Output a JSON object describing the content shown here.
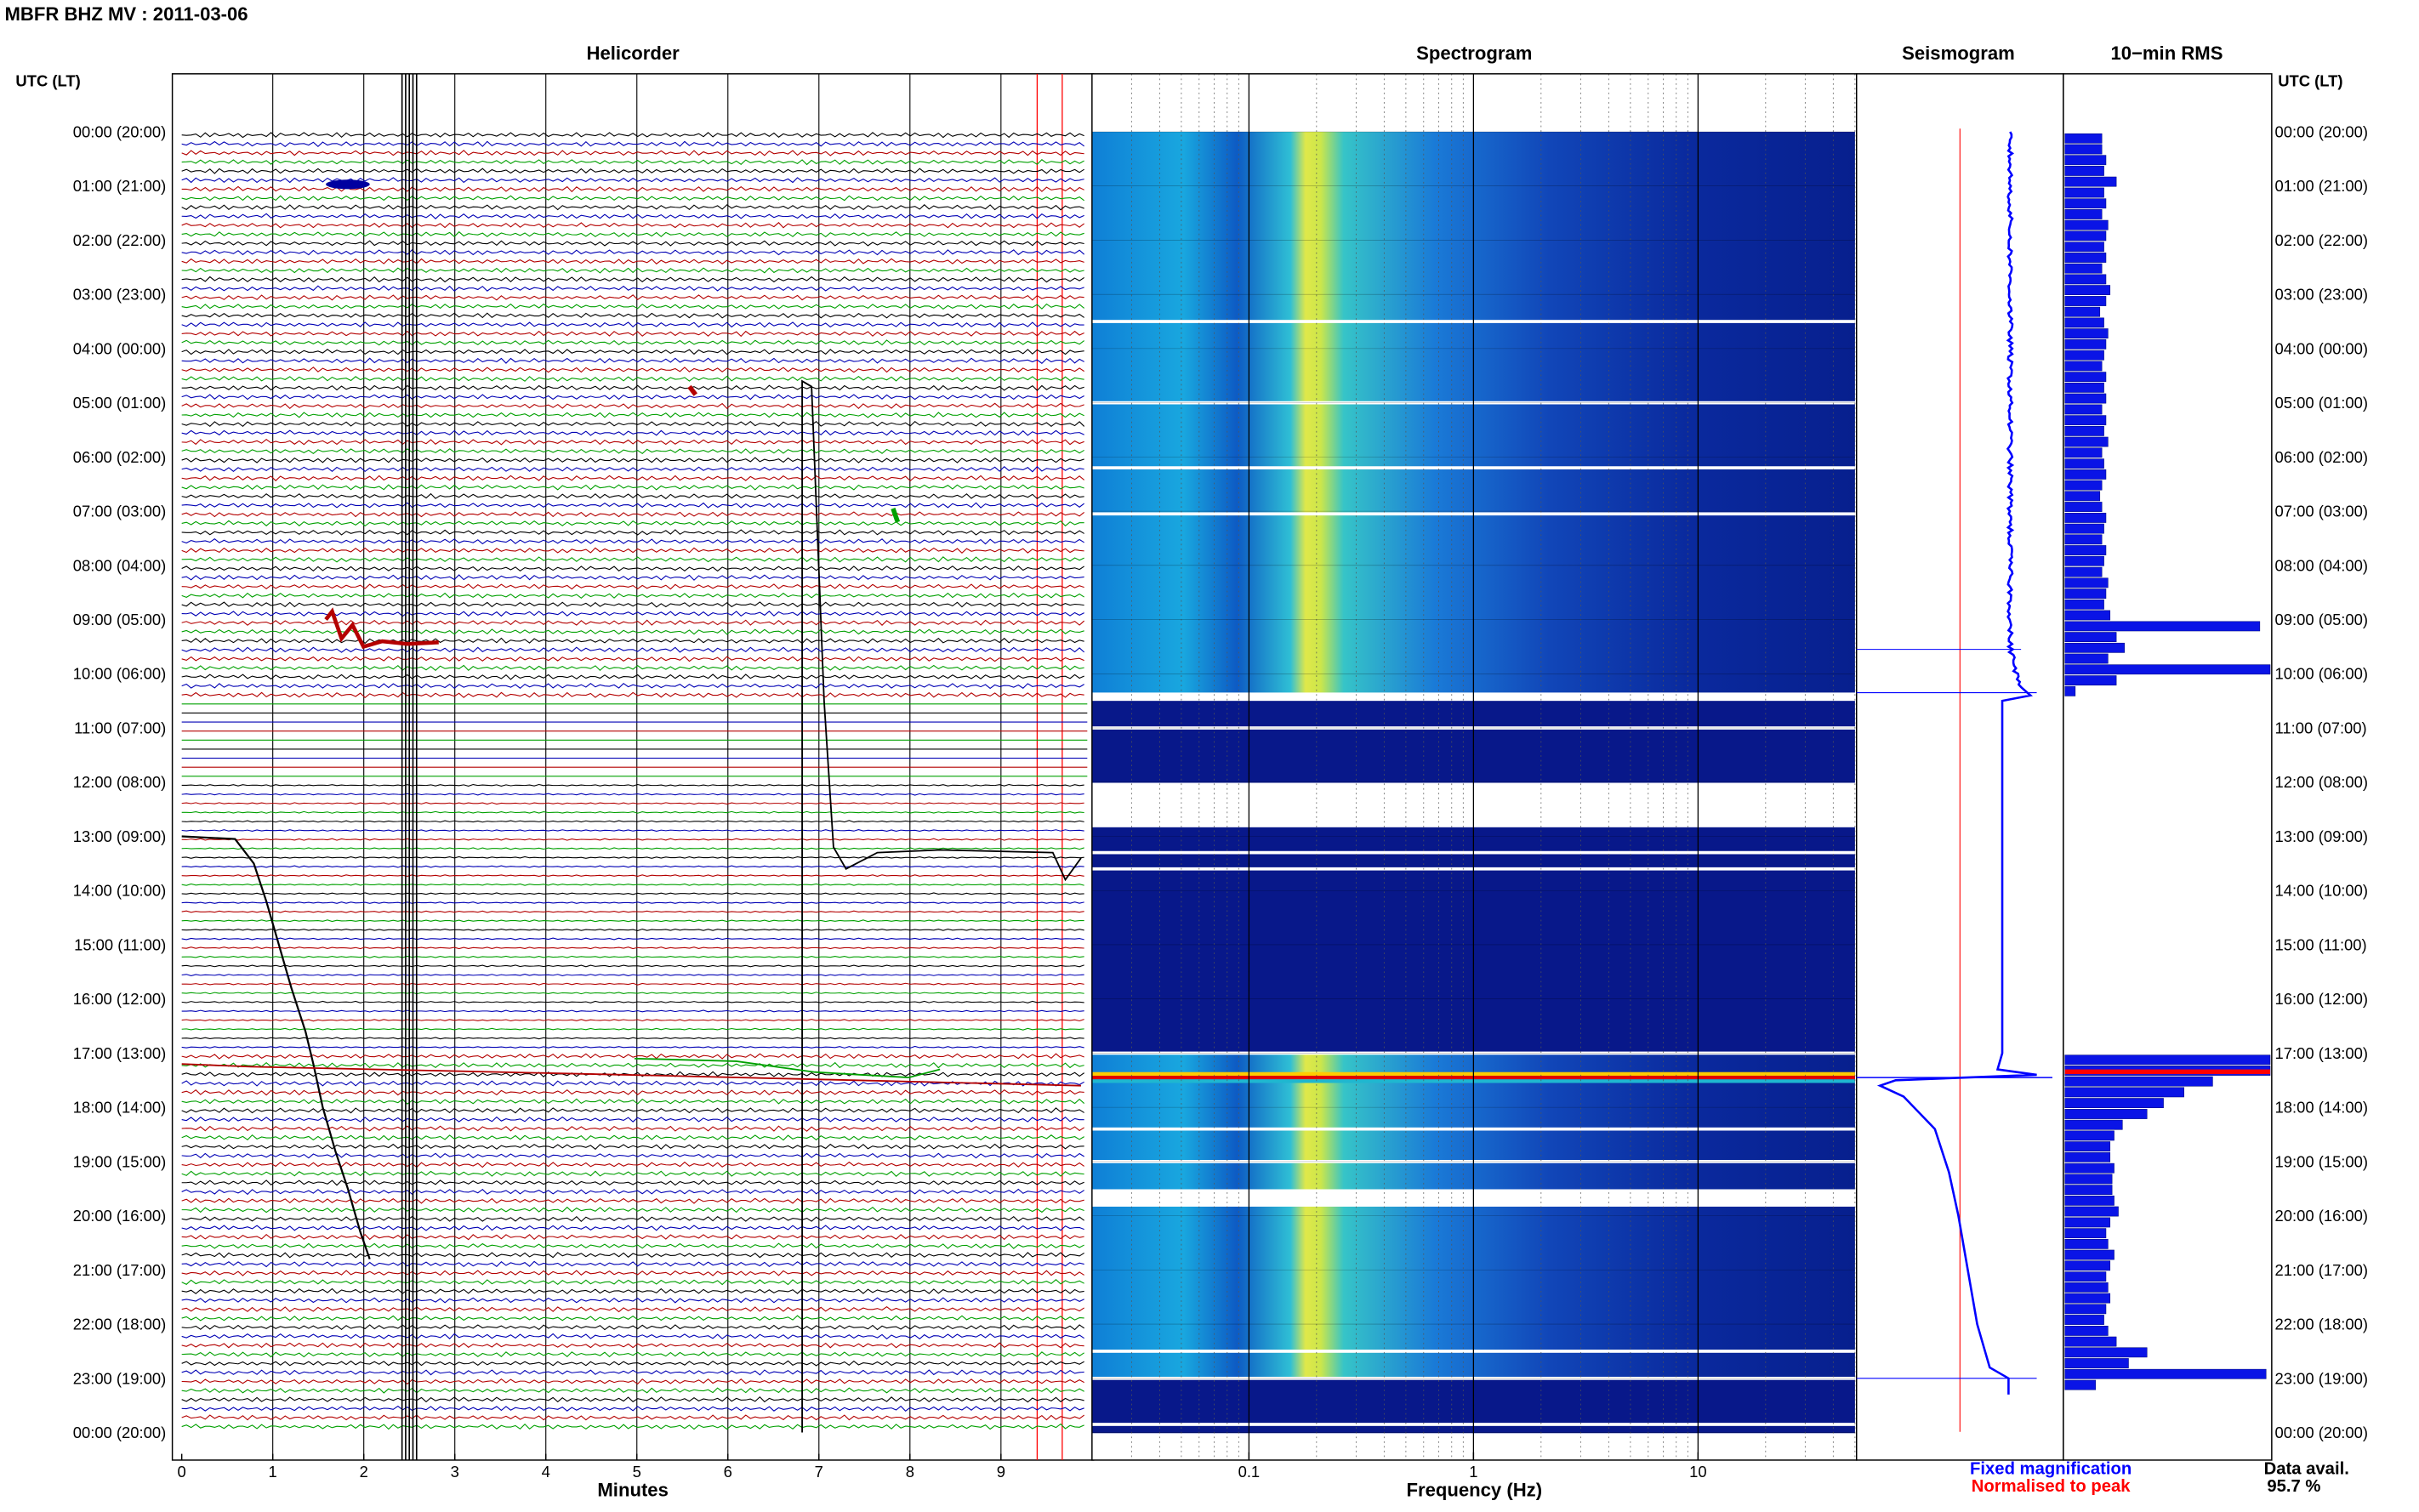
{
  "header": {
    "station_title": "MBFR BHZ MV : 2011-03-06"
  },
  "panels": {
    "helicorder_title": "Helicorder",
    "spectrogram_title": "Spectrogram",
    "seismogram_title": "Seismogram",
    "rms_title": "10−min RMS"
  },
  "axes": {
    "time_axis_label": "UTC (LT)",
    "time_ticks": [
      "00:00 (20:00)",
      "01:00 (21:00)",
      "02:00 (22:00)",
      "03:00 (23:00)",
      "04:00 (00:00)",
      "05:00 (01:00)",
      "06:00 (02:00)",
      "07:00 (03:00)",
      "08:00 (04:00)",
      "09:00 (05:00)",
      "10:00 (06:00)",
      "11:00 (07:00)",
      "12:00 (08:00)",
      "13:00 (09:00)",
      "14:00 (10:00)",
      "15:00 (11:00)",
      "16:00 (12:00)",
      "17:00 (13:00)",
      "18:00 (14:00)",
      "19:00 (15:00)",
      "20:00 (16:00)",
      "21:00 (17:00)",
      "22:00 (18:00)",
      "23:00 (19:00)",
      "00:00 (20:00)"
    ],
    "minutes_label": "Minutes",
    "minutes_ticks": [
      "0",
      "1",
      "2",
      "3",
      "4",
      "5",
      "6",
      "7",
      "8",
      "9"
    ],
    "frequency_label": "Frequency (Hz)",
    "frequency_ticks": [
      "0.1",
      "1",
      "10"
    ]
  },
  "legend": {
    "fixed_label": "Fixed magnification",
    "normalised_label": "Normalised to peak",
    "fixed_color": "#0000ff",
    "normalised_color": "#ff0000"
  },
  "availability": {
    "label": "Data avail.",
    "value": "95.7 %"
  },
  "chart_data": [
    {
      "type": "line",
      "panel": "helicorder",
      "xlabel": "Minutes",
      "xlim": [
        0,
        10
      ],
      "ylim": [
        "00:00",
        "24:00"
      ],
      "row_minutes": 10,
      "trace_colors": [
        "#000000",
        "#0000b4",
        "#b40000",
        "#00a000"
      ],
      "gaps_hours": [
        [
          10.4,
          12.0
        ]
      ],
      "events_hours": [
        1.0,
        9.4,
        17.5
      ]
    },
    {
      "type": "heatmap",
      "panel": "spectrogram",
      "xlabel": "Frequency (Hz)",
      "xscale": "log",
      "xlim": [
        0.02,
        50
      ],
      "peak_band_hz": [
        0.2,
        0.28
      ],
      "gaps_hours": [
        [
          12.0,
          12.75
        ],
        [
          19.5,
          19.8
        ]
      ],
      "low_data_hours": [
        [
          10.4,
          12.0
        ],
        [
          12.75,
          17.0
        ],
        [
          23.0,
          24.0
        ]
      ],
      "saturated_hours": [
        17.35,
        17.55
      ]
    },
    {
      "type": "line",
      "panel": "seismogram",
      "series": [
        {
          "name": "Fixed magnification",
          "color": "#0000ff"
        },
        {
          "name": "Normalised to peak",
          "color": "#ff0000"
        }
      ]
    },
    {
      "type": "bar",
      "panel": "10-min RMS",
      "orientation": "horizontal",
      "bin_minutes": 10,
      "hours": [
        0.2,
        0.4,
        0.6,
        0.8,
        1.0,
        1.2,
        1.4,
        1.6,
        1.8,
        2.0,
        2.2,
        2.4,
        2.6,
        2.8,
        3.0,
        3.2,
        3.4,
        3.6,
        3.8,
        4.0,
        4.2,
        4.4,
        4.6,
        4.8,
        5.0,
        5.2,
        5.4,
        5.6,
        5.8,
        6.0,
        6.2,
        6.4,
        6.6,
        6.8,
        7.0,
        7.2,
        7.4,
        7.6,
        7.8,
        8.0,
        8.2,
        8.4,
        8.6,
        8.8,
        9.0,
        9.2,
        9.4,
        9.6,
        9.8,
        10.0,
        10.2,
        10.4,
        17.2,
        17.4,
        17.6,
        17.8,
        18.0,
        18.2,
        18.4,
        18.6,
        18.8,
        19.0,
        19.2,
        19.4,
        19.6,
        19.8,
        20.0,
        20.2,
        20.4,
        20.6,
        20.8,
        21.0,
        21.2,
        21.4,
        21.6,
        21.8,
        22.0,
        22.2,
        22.4,
        22.6,
        22.8,
        23.0,
        23.2
      ],
      "values": [
        0.18,
        0.18,
        0.2,
        0.19,
        0.25,
        0.19,
        0.2,
        0.18,
        0.21,
        0.2,
        0.19,
        0.2,
        0.18,
        0.2,
        0.22,
        0.2,
        0.17,
        0.19,
        0.21,
        0.2,
        0.19,
        0.18,
        0.2,
        0.19,
        0.2,
        0.18,
        0.2,
        0.19,
        0.21,
        0.18,
        0.19,
        0.2,
        0.18,
        0.17,
        0.18,
        0.2,
        0.19,
        0.18,
        0.2,
        0.19,
        0.18,
        0.21,
        0.2,
        0.19,
        0.22,
        0.95,
        0.25,
        0.29,
        0.21,
        1.0,
        0.25,
        0.05,
        1.0,
        1.0,
        0.72,
        0.58,
        0.48,
        0.4,
        0.28,
        0.24,
        0.22,
        0.22,
        0.24,
        0.23,
        0.23,
        0.24,
        0.26,
        0.22,
        0.2,
        0.21,
        0.24,
        0.22,
        0.2,
        0.21,
        0.22,
        0.2,
        0.19,
        0.21,
        0.25,
        0.4,
        0.31,
        0.98,
        0.15
      ]
    }
  ]
}
